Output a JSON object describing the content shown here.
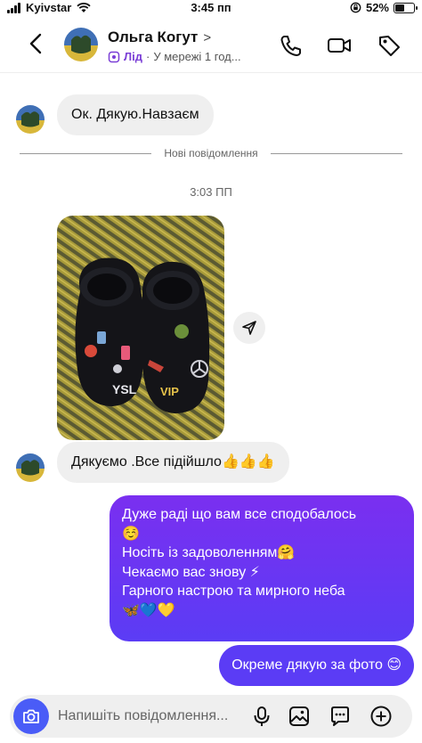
{
  "status_bar": {
    "carrier": "Kyivstar",
    "time": "3:45 пп",
    "battery": "52%",
    "battery_level": 0.52
  },
  "header": {
    "name": "Ольга Когут",
    "chevron": ">",
    "label": "Лід",
    "separator": "·",
    "presence": "У мережі 1 год..."
  },
  "chat": {
    "msg1": "Ок. Дякую.Навзаєм",
    "divider": "Нові повідомлення",
    "timestamp": "3:03 ПП",
    "msg2": "Дякуємо .Все підійшло👍👍👍",
    "reply_lines": [
      "Дуже раді що вам все сподобалось",
      "☺️",
      "Носіть із задоволенням🤗",
      "Чекаємо вас знову ⚡",
      "Гарного настрою та мирного неба",
      "🦋💙💛"
    ],
    "reply2": "Окреме дякую за фото 😊"
  },
  "composer": {
    "placeholder": "Напишіть повідомлення..."
  },
  "colors": {
    "accent": "#5b3cf5",
    "accent_top": "#7a2ff0",
    "bubble_in": "#efefef",
    "lead": "#7b3fd6",
    "camera": "#4a5cf7"
  },
  "icons": [
    "back-icon",
    "phone-icon",
    "video-icon",
    "tag-icon",
    "share-icon",
    "camera-icon",
    "mic-icon",
    "gallery-icon",
    "sticker-icon",
    "plus-icon"
  ]
}
